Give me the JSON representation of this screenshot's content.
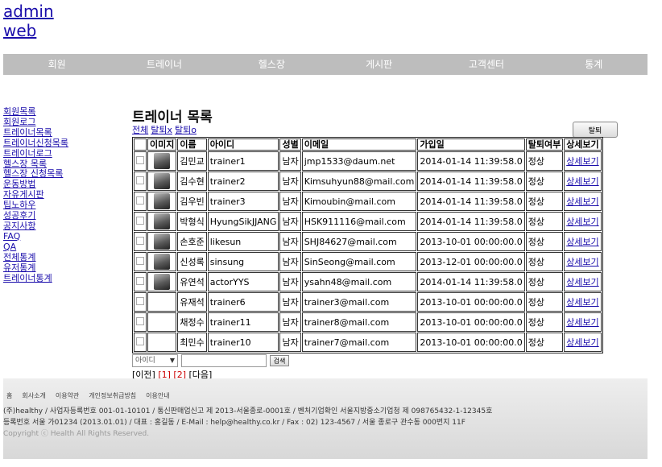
{
  "logo": {
    "line1": "admin",
    "line2": "web"
  },
  "nav": [
    "회원",
    "트레이너",
    "헬스장",
    "게시판",
    "고객센터",
    "통계"
  ],
  "sidebar": [
    "회원목록",
    "회원로그",
    "트레이너목록",
    "트레이너신청목록",
    "트레이너로그",
    "헬스장 목록",
    "헬스장 신청목록",
    "운동방법",
    "자유게시판",
    "팁노하우",
    "성공후기",
    "공지사항",
    "FAQ",
    "QA",
    "전체통계",
    "유저통계",
    "트레이너통계"
  ],
  "page": {
    "title": "트레이너 목록",
    "filters": [
      "전체",
      "탈퇴x",
      "탈퇴o"
    ],
    "delete_label": "탈퇴"
  },
  "table": {
    "headers": [
      "",
      "이미지",
      "이름",
      "아이디",
      "성별",
      "이메일",
      "가입일",
      "탈퇴여부",
      "상세보기"
    ],
    "rows": [
      {
        "photo": true,
        "name": "김민교",
        "id": "trainer1",
        "gender": "남자",
        "email": "jmp1533@daum.net",
        "joined": "2014-01-14 11:39:58.0",
        "status": "정상",
        "detail": "상세보기"
      },
      {
        "photo": true,
        "name": "김수현",
        "id": "trainer2",
        "gender": "남자",
        "email": "Kimsuhyun88@mail.com",
        "joined": "2014-01-14 11:39:58.0",
        "status": "정상",
        "detail": "상세보기"
      },
      {
        "photo": true,
        "name": "김우빈",
        "id": "trainer3",
        "gender": "남자",
        "email": "Kimoubin@mail.com",
        "joined": "2014-01-14 11:39:58.0",
        "status": "정상",
        "detail": "상세보기"
      },
      {
        "photo": true,
        "name": "박형식",
        "id": "HyungSikJJANG",
        "gender": "남자",
        "email": "HSK911116@mail.com",
        "joined": "2014-01-14 11:39:58.0",
        "status": "정상",
        "detail": "상세보기"
      },
      {
        "photo": true,
        "name": "손호준",
        "id": "likesun",
        "gender": "남자",
        "email": "SHJ84627@mail.com",
        "joined": "2013-10-01 00:00:00.0",
        "status": "정상",
        "detail": "상세보기"
      },
      {
        "photo": true,
        "name": "신성록",
        "id": "sinsung",
        "gender": "남자",
        "email": "SinSeong@mail.com",
        "joined": "2013-12-01 00:00:00.0",
        "status": "정상",
        "detail": "상세보기"
      },
      {
        "photo": true,
        "name": "유연석",
        "id": "actorYYS",
        "gender": "남자",
        "email": "ysahn48@mail.com",
        "joined": "2014-01-14 11:39:58.0",
        "status": "정상",
        "detail": "상세보기"
      },
      {
        "photo": false,
        "name": "유재석",
        "id": "trainer6",
        "gender": "남자",
        "email": "trainer3@mail.com",
        "joined": "2013-10-01 00:00:00.0",
        "status": "정상",
        "detail": "상세보기"
      },
      {
        "photo": false,
        "name": "채정수",
        "id": "trainer11",
        "gender": "남자",
        "email": "trainer8@mail.com",
        "joined": "2013-10-01 00:00:00.0",
        "status": "정상",
        "detail": "상세보기"
      },
      {
        "photo": false,
        "name": "최민수",
        "id": "trainer10",
        "gender": "남자",
        "email": "trainer7@mail.com",
        "joined": "2013-10-01 00:00:00.0",
        "status": "정상",
        "detail": "상세보기"
      }
    ]
  },
  "search": {
    "select_value": "아이디",
    "button": "검색"
  },
  "pager": {
    "prev": "[이전]",
    "pages": [
      "[1]",
      "[2]"
    ],
    "next": "[다음]"
  },
  "footer": {
    "links": [
      "홈",
      "회사소개",
      "이용약관",
      "개인정보취급방침",
      "이용안내"
    ],
    "line1": "(주)healthy / 사업자등록번호 001-01-10101 / 통신판매업신고 제 2013-서울종로-0001호 / 벤처기업확인 서울지방중소기업청 제 098765432-1-12345호",
    "line2": "등록번호 서울 가01234 (2013.01.01) / 대표 : 홍길동 / E-Mail : help@healthy.co.kr / Fax : 02) 123-4567 / 서울 종로구 관수동 000번지 11F",
    "copyright": "Copyright ⓒ Health All Rights Reserved."
  }
}
